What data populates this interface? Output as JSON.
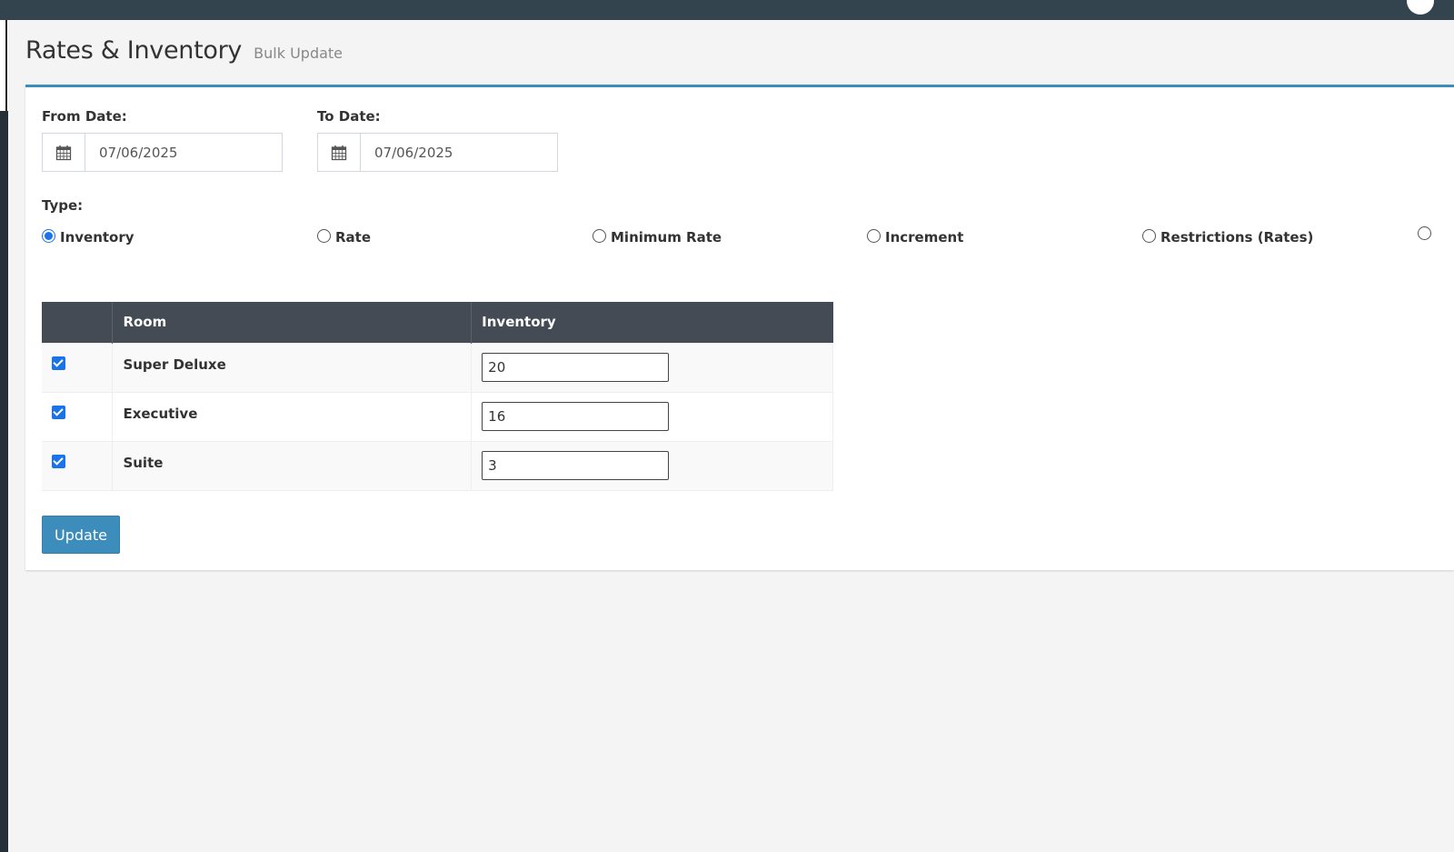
{
  "page": {
    "title": "Rates & Inventory",
    "subtitle": "Bulk Update"
  },
  "form": {
    "from_date": {
      "label": "From Date:",
      "value": "07/06/2025",
      "icon": "calendar-icon"
    },
    "to_date": {
      "label": "To Date:",
      "value": "07/06/2025",
      "icon": "calendar-icon"
    },
    "type": {
      "label": "Type:",
      "selected": "Inventory",
      "options": [
        {
          "label": "Inventory",
          "checked": true
        },
        {
          "label": "Rate",
          "checked": false
        },
        {
          "label": "Minimum Rate",
          "checked": false
        },
        {
          "label": "Increment",
          "checked": false
        },
        {
          "label": "Restrictions (Rates)",
          "checked": false
        }
      ]
    }
  },
  "table": {
    "columns": [
      "",
      "Room",
      "Inventory"
    ],
    "rows": [
      {
        "checked": true,
        "room": "Super Deluxe",
        "inventory": "20"
      },
      {
        "checked": true,
        "room": "Executive",
        "inventory": "16"
      },
      {
        "checked": true,
        "room": "Suite",
        "inventory": "3"
      }
    ]
  },
  "actions": {
    "update_label": "Update"
  },
  "colors": {
    "topbar": "#34444f",
    "accent": "#3c8dbc",
    "table_header": "#444b55",
    "checkbox": "#1a73e8"
  }
}
